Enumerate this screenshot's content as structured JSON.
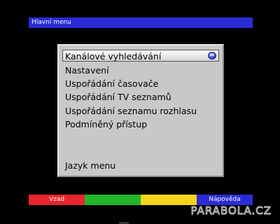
{
  "header": {
    "title": "Hlavní menu"
  },
  "menu": {
    "selected_index": 0,
    "ok_icon": "ok-button-icon",
    "ok_label": "ok",
    "items": [
      {
        "label": "Kanálové vyhledávání"
      },
      {
        "label": "Nastavení"
      },
      {
        "label": "Uspořádání časovače"
      },
      {
        "label": "Uspořádání TV seznamů"
      },
      {
        "label": "Uspořádání seznamu rozhlasu"
      },
      {
        "label": "Podmíněný přístup"
      },
      {
        "label": "Jazyk menu"
      }
    ]
  },
  "color_keys": {
    "red_label": "Vzad",
    "green_label": "",
    "yellow_label": "",
    "blue_label": "Nápověda",
    "colors": {
      "red": "#e8242c",
      "green": "#22b52a",
      "yellow": "#f2d51a",
      "blue": "#2b2bd6"
    }
  },
  "watermark": {
    "text": "PARABOLA.CZ"
  },
  "colors": {
    "background": "#000000",
    "title_bar": "#2b2bd6",
    "panel": "#c8c8c8"
  }
}
